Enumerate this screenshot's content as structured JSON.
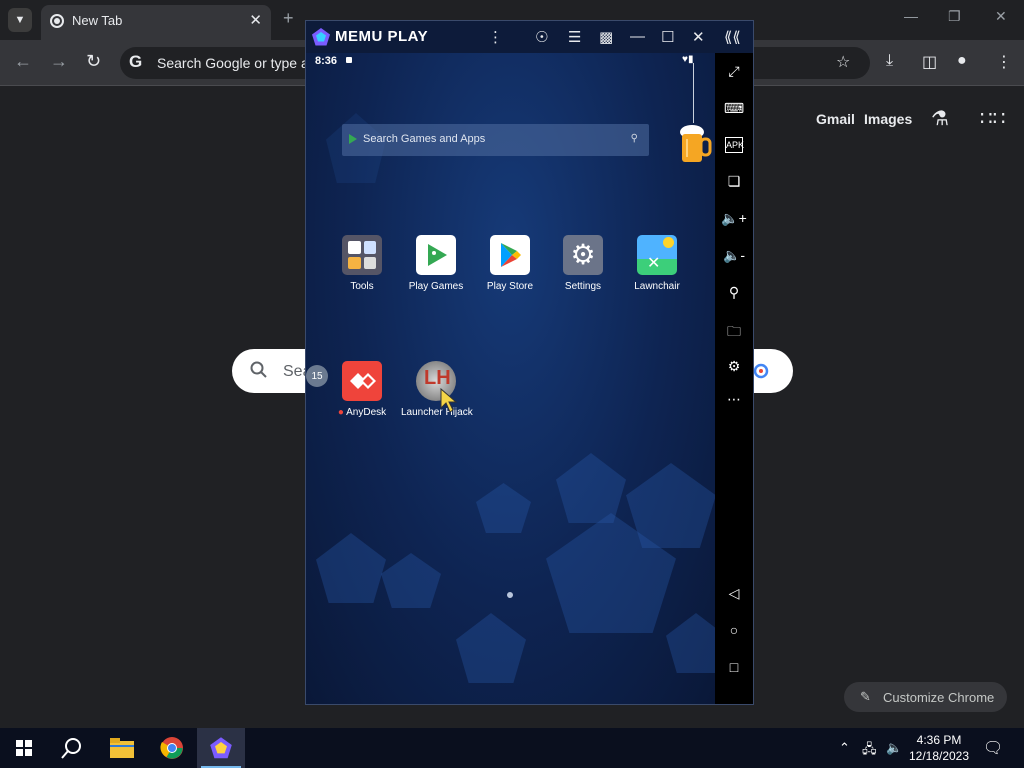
{
  "chrome": {
    "tab_title": "New Tab",
    "omnibox_text": "Search Google or type a",
    "ntp_links": [
      "Gmail",
      "Images"
    ],
    "search_placeholder": "Sea",
    "customize_label": "Customize Chrome"
  },
  "memu": {
    "brand": "MEMU PLAY",
    "status_time": "8:36",
    "search_placeholder": "Search Games and Apps",
    "badge_count": "15",
    "apps_row1": [
      {
        "label": "Tools",
        "icon": "tools-folder-icon"
      },
      {
        "label": "Play Games",
        "icon": "play-games-icon"
      },
      {
        "label": "Play Store",
        "icon": "play-store-icon"
      },
      {
        "label": "Settings",
        "icon": "settings-gear-icon"
      },
      {
        "label": "Lawnchair",
        "icon": "lawnchair-icon"
      }
    ],
    "apps_row2": [
      {
        "label": "AnyDesk",
        "icon": "anydesk-icon"
      },
      {
        "label": "Launcher Hijack",
        "icon": "launcher-hijack-icon"
      }
    ],
    "sidebar_tools": [
      "fullscreen-icon",
      "keyboard-icon",
      "apk-icon",
      "multi-instance-icon",
      "volume-up-icon",
      "volume-down-icon",
      "location-icon",
      "folder-icon",
      "settings-icon",
      "more-icon",
      "back-icon",
      "home-icon",
      "recents-icon"
    ]
  },
  "taskbar": {
    "time": "4:36 PM",
    "date": "12/18/2023"
  },
  "colors": {
    "chrome_bg": "#202124",
    "memu_bg": "#0e2452",
    "accent": "#76b9ed"
  }
}
